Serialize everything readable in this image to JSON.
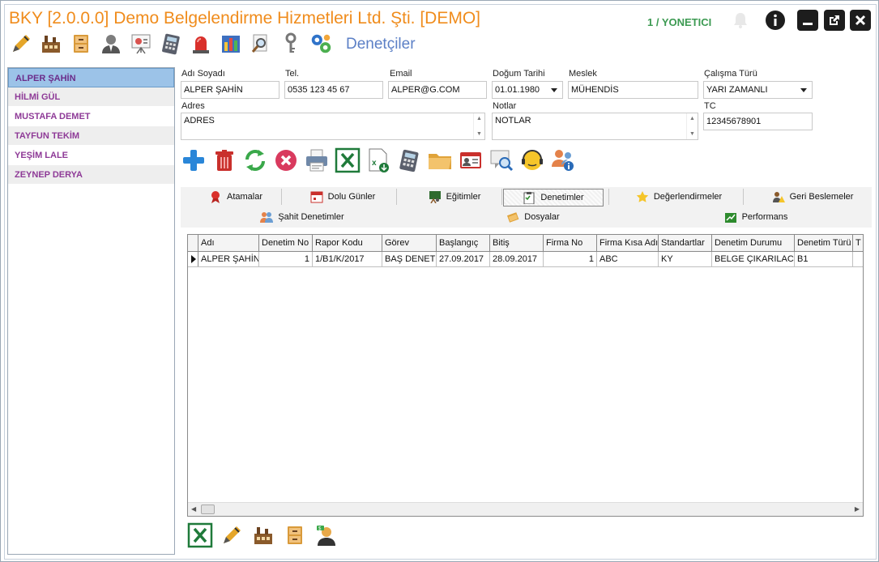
{
  "window": {
    "title": "BKY [2.0.0.0] Demo Belgelendirme Hizmetleri Ltd. Şti. [DEMO]",
    "user": "1 / YONETICI",
    "page_title": "Denetçiler"
  },
  "main_toolbar": {
    "icons": [
      "pen-icon",
      "factory-icon",
      "cabinet-icon",
      "person-icon",
      "presentation-icon",
      "calculator-icon",
      "alarm-light-icon",
      "bar-chart-icon",
      "search-document-icon",
      "key-icon",
      "gears-icon"
    ]
  },
  "auditors": [
    {
      "name": "ALPER ŞAHİN",
      "selected": true
    },
    {
      "name": "HİLMİ GÜL",
      "selected": false
    },
    {
      "name": "MUSTAFA DEMET",
      "selected": false
    },
    {
      "name": "TAYFUN TEKİM",
      "selected": false
    },
    {
      "name": "YEŞİM LALE",
      "selected": false
    },
    {
      "name": "ZEYNEP DERYA",
      "selected": false
    }
  ],
  "form": {
    "name_label": "Adı Soyadı",
    "name_value": "ALPER ŞAHİN",
    "phone_label": "Tel.",
    "phone_value": "0535 123 45 67",
    "email_label": "Email",
    "email_value": "ALPER@G.COM",
    "birth_label": "Doğum Tarihi",
    "birth_value": "01.01.1980",
    "job_label": "Meslek",
    "job_value": "MÜHENDİS",
    "worktype_label": "Çalışma Türü",
    "worktype_value": "YARI ZAMANLI",
    "address_label": "Adres",
    "address_value": "ADRES",
    "notes_label": "Notlar",
    "notes_value": "NOTLAR",
    "tc_label": "TC",
    "tc_value": "12345678901"
  },
  "action_toolbar": {
    "icons": [
      "add-icon",
      "delete-icon",
      "refresh-icon",
      "cancel-icon",
      "print-icon",
      "excel-icon",
      "excel-export-icon",
      "calculator-icon",
      "folder-icon",
      "id-card-icon",
      "search-screen-icon",
      "support-icon",
      "user-info-icon"
    ]
  },
  "tabs_row1": [
    {
      "label": "Atamalar",
      "icon": "ribbon-icon"
    },
    {
      "label": "Dolu Günler",
      "icon": "calendar-icon"
    },
    {
      "label": "Eğitimler",
      "icon": "training-board-icon"
    },
    {
      "label": "Denetimler",
      "icon": "clipboard-icon",
      "selected": true
    },
    {
      "label": "Değerlendirmeler",
      "icon": "star-icon"
    },
    {
      "label": "Geri Beslemeler",
      "icon": "warning-user-icon"
    }
  ],
  "tabs_row2": [
    {
      "label": "Şahit Denetimler",
      "icon": "users-icon"
    },
    {
      "label": "Dosyalar",
      "icon": "files-icon"
    },
    {
      "label": "Performans",
      "icon": "chart-up-icon"
    }
  ],
  "grid": {
    "columns": [
      "Adı",
      "Denetim No",
      "Rapor Kodu",
      "Görev",
      "Başlangıç",
      "Bitiş",
      "Firma No",
      "Firma Kısa Adı",
      "Standartlar",
      "Denetim Durumu",
      "Denetim Türü",
      "T"
    ],
    "rows": [
      [
        "ALPER ŞAHİN",
        "1",
        "1/B1/K/2017",
        "BAŞ DENETÇİ",
        "27.09.2017",
        "28.09.2017",
        "1",
        "ABC",
        "KY",
        "BELGE ÇIKARILACAK",
        "B1",
        ""
      ]
    ]
  },
  "bottom_toolbar": {
    "icons": [
      "excel-icon",
      "pen-icon",
      "factory-icon",
      "cabinet-icon",
      "money-user-icon"
    ]
  },
  "colors": {
    "title": "#f08c1c",
    "user": "#3c9a52",
    "page_title": "#5c80c6",
    "list_text": "#8e3a97",
    "list_selected": "#9cc3e8"
  }
}
